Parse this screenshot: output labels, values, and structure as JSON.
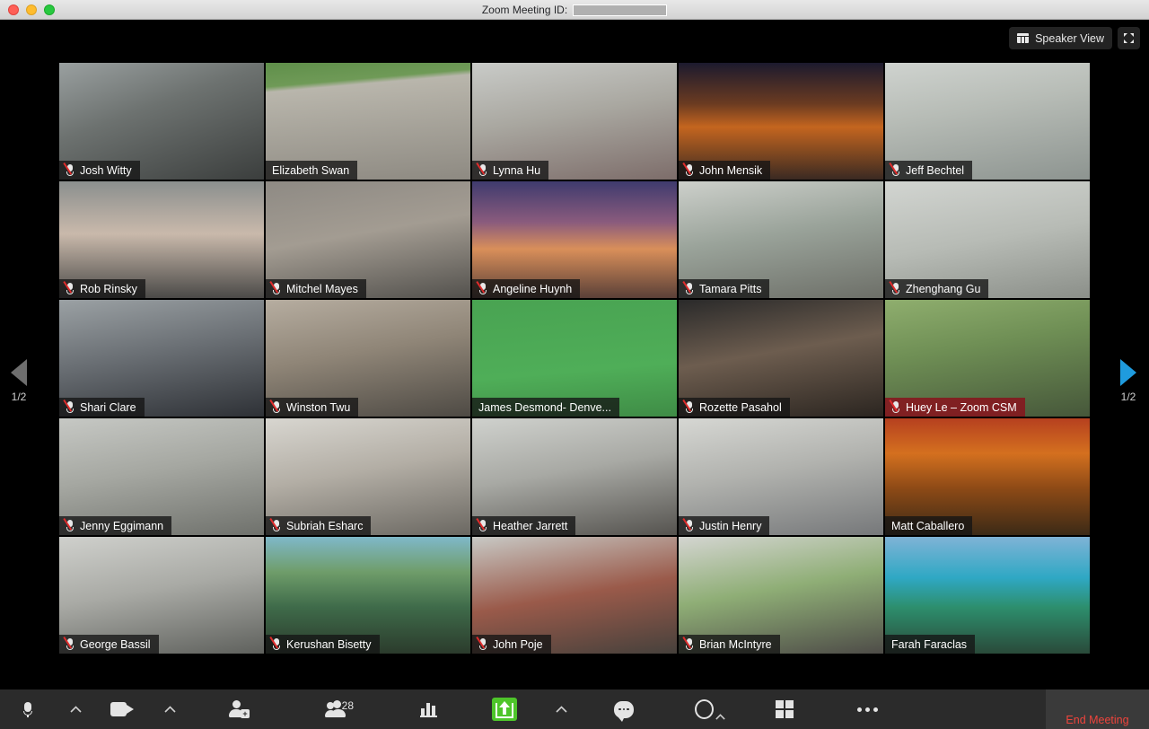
{
  "window": {
    "title_prefix": "Zoom Meeting ID:",
    "meeting_id_masked": true,
    "traffic_lights": [
      "close-button",
      "minimize-button",
      "maximize-button"
    ]
  },
  "view_controls": {
    "speaker_view_label": "Speaker View",
    "speaker_view_icon": "gallery-icon",
    "fullscreen_icon": "fullscreen-icon"
  },
  "pager": {
    "left_label": "1/2",
    "right_label": "1/2",
    "left_enabled": false,
    "right_enabled": true,
    "left_icon": "chevron-left-icon",
    "right_icon": "chevron-right-icon"
  },
  "colors": {
    "active_speaker_border": "#d7f205",
    "highlight_nameplate": "#86161e",
    "share_green": "#4ec52a",
    "end_meeting_red": "#f0443c",
    "pager_active_blue": "#1f9bde"
  },
  "participants": [
    {
      "name": "Josh Witty",
      "muted": true,
      "active": false,
      "highlight": false,
      "bg": "linear-gradient(160deg,#9aa0a0 0%,#6d7270 40%,#3b3e3d 100%)"
    },
    {
      "name": "Elizabeth Swan",
      "muted": false,
      "active": false,
      "highlight": false,
      "bg": "linear-gradient(175deg,#5f8f4a 0%,#6f9a57 18%,#b9b6ac 22%,#8e8a82 100%)"
    },
    {
      "name": "Lynna Hu",
      "muted": true,
      "active": false,
      "highlight": false,
      "bg": "linear-gradient(170deg,#c9cbc8 0%,#a9a7a0 45%,#7d6d6a 100%)"
    },
    {
      "name": "John Mensik",
      "muted": true,
      "active": false,
      "highlight": false,
      "bg": "linear-gradient(180deg,#1c1a2e 0%,#6b3b21 35%,#c4651f 55%,#3a2a22 100%)"
    },
    {
      "name": "Jeff Bechtel",
      "muted": true,
      "active": false,
      "highlight": false,
      "bg": "linear-gradient(170deg,#cfd3cf 0%,#b7bcb6 40%,#8d9490 100%)"
    },
    {
      "name": "Rob Rinsky",
      "muted": true,
      "active": false,
      "highlight": false,
      "bg": "linear-gradient(180deg,#8b8f8e 0%,#c9b9ab 45%,#4b4a48 100%)"
    },
    {
      "name": "Mitchel Mayes",
      "muted": true,
      "active": false,
      "highlight": false,
      "bg": "linear-gradient(170deg,#8e8a84 0%,#a39c92 45%,#53514d 100%)"
    },
    {
      "name": "Angeline Huynh",
      "muted": true,
      "active": false,
      "highlight": false,
      "bg": "linear-gradient(180deg,#3f3b6e 0%,#8a5b7d 35%,#d98f5a 58%,#5a4038 100%)"
    },
    {
      "name": "Tamara Pitts",
      "muted": true,
      "active": false,
      "highlight": false,
      "bg": "linear-gradient(170deg,#cdd0cb 0%,#9aa39a 45%,#6d6f68 100%)"
    },
    {
      "name": "Zhenghang Gu",
      "muted": true,
      "active": false,
      "highlight": false,
      "bg": "linear-gradient(170deg,#d2d5d1 0%,#b7bbb5 50%,#8b8f89 100%)"
    },
    {
      "name": "Shari Clare",
      "muted": true,
      "active": false,
      "highlight": false,
      "bg": "linear-gradient(170deg,#9ba1a4 0%,#6a6f74 45%,#2e3136 100%)"
    },
    {
      "name": "Winston Twu",
      "muted": true,
      "active": false,
      "highlight": false,
      "bg": "linear-gradient(170deg,#b6ada0 0%,#8f8577 45%,#4e4a44 100%)"
    },
    {
      "name": "James Desmond- Denve...",
      "muted": false,
      "active": false,
      "highlight": false,
      "bg": "linear-gradient(175deg,#49a352 0%,#4fae58 60%,#3f8c46 100%)"
    },
    {
      "name": "Rozette Pasahol",
      "muted": true,
      "active": false,
      "highlight": false,
      "bg": "linear-gradient(170deg,#2a2a2a 0%,#6d5d4f 45%,#2b2520 100%)"
    },
    {
      "name": "Huey Le – Zoom CSM",
      "muted": true,
      "active": false,
      "highlight": true,
      "bg": "linear-gradient(170deg,#8fae6e 0%,#6f8f55 40%,#46573a 100%)"
    },
    {
      "name": "Jenny Eggimann",
      "muted": true,
      "active": false,
      "highlight": false,
      "bg": "linear-gradient(170deg,#c6c8c4 0%,#a5a7a1 45%,#6f716c 100%)"
    },
    {
      "name": "Subriah Esharc",
      "muted": true,
      "active": false,
      "highlight": false,
      "bg": "linear-gradient(170deg,#d8d6d0 0%,#b3aea5 45%,#6b6862 100%)"
    },
    {
      "name": "Heather Jarrett",
      "muted": true,
      "active": false,
      "highlight": false,
      "bg": "linear-gradient(170deg,#cfd1cd 0%,#a8a9a4 45%,#55534f 100%)"
    },
    {
      "name": "Justin Henry",
      "muted": true,
      "active": false,
      "highlight": false,
      "bg": "linear-gradient(170deg,#d6d7d3 0%,#b1b2ae 45%,#76787a 100%)"
    },
    {
      "name": "Matt Caballero",
      "muted": false,
      "active": false,
      "highlight": false,
      "bg": "linear-gradient(180deg,#b6401f 0%,#d4701f 30%,#8d4a16 60%,#3c2a16 100%)"
    },
    {
      "name": "George Bassil",
      "muted": true,
      "active": false,
      "highlight": false,
      "bg": "linear-gradient(170deg,#cfd0cc 0%,#a9aaa5 45%,#5f615d 100%)"
    },
    {
      "name": "Kerushan Bisetty",
      "muted": true,
      "active": false,
      "highlight": false,
      "bg": "linear-gradient(180deg,#7fb8c9 0%,#6f9d6a 30%,#3f6b4a 60%,#2b3b2c 100%)"
    },
    {
      "name": "John Poje",
      "muted": true,
      "active": false,
      "highlight": false,
      "bg": "linear-gradient(170deg,#c8c9c5 0%,#9a5a4a 50%,#46413c 100%)"
    },
    {
      "name": "Brian McIntyre",
      "muted": true,
      "active": false,
      "highlight": false,
      "bg": "linear-gradient(170deg,#d4d5d1 0%,#8fae76 45%,#4e4c48 100%)"
    },
    {
      "name": "Farah Faraclas",
      "muted": false,
      "active": true,
      "highlight": false,
      "bg": "linear-gradient(180deg,#7fb3d6 0%,#2fa8c4 35%,#2d8f6e 60%,#2a4a3a 100%)"
    }
  ],
  "toolbar": {
    "mute_label": "",
    "mute_icon": "microphone-icon",
    "mute_chevron_icon": "chevron-up-icon",
    "video_icon": "video-camera-icon",
    "video_chevron_icon": "chevron-up-icon",
    "invite_icon": "invite-person-icon",
    "participants_icon": "participants-icon",
    "participants_count": "28",
    "polling_icon": "polling-chart-icon",
    "share_icon": "share-screen-icon",
    "share_chevron_icon": "chevron-up-icon",
    "chat_icon": "chat-bubble-icon",
    "record_icon": "record-icon",
    "record_chevron_icon": "chevron-up-icon",
    "breakout_icon": "breakout-rooms-icon",
    "more_icon": "more-options-icon",
    "end_meeting_label": "End Meeting"
  }
}
